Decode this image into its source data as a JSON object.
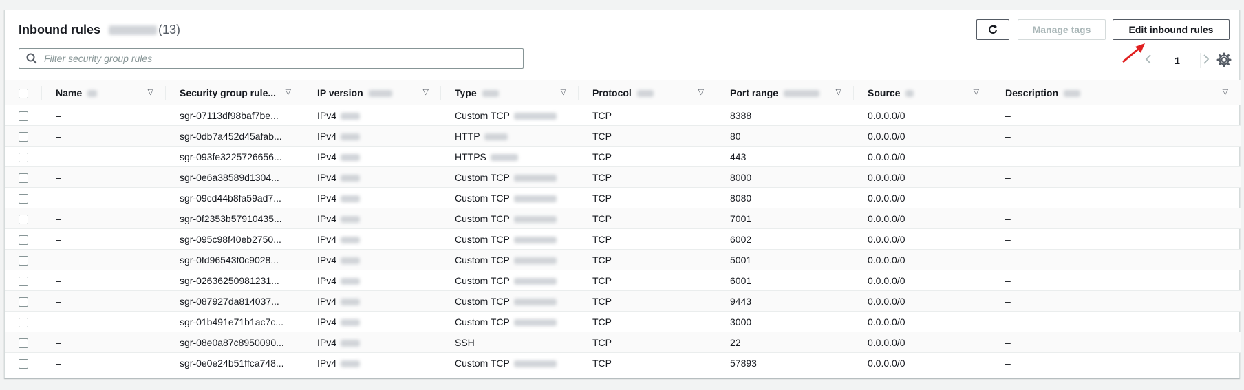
{
  "header": {
    "title": "Inbound rules",
    "count": "(13)"
  },
  "toolbar": {
    "manage_tags_label": "Manage tags",
    "edit_inbound_label": "Edit inbound rules"
  },
  "search": {
    "placeholder": "Filter security group rules"
  },
  "pagination": {
    "current_page": "1"
  },
  "table": {
    "columns": [
      "Name",
      "Security group rule...",
      "IP version",
      "Type",
      "Protocol",
      "Port range",
      "Source",
      "Description"
    ],
    "rows": [
      {
        "name": "–",
        "rule_id": "sgr-07113df98baf7be...",
        "ip_version": "IPv4",
        "type": "Custom TCP",
        "protocol": "TCP",
        "port_range": "8388",
        "source": "0.0.0.0/0",
        "description": "–"
      },
      {
        "name": "–",
        "rule_id": "sgr-0db7a452d45afab...",
        "ip_version": "IPv4",
        "type": "HTTP",
        "protocol": "TCP",
        "port_range": "80",
        "source": "0.0.0.0/0",
        "description": "–"
      },
      {
        "name": "–",
        "rule_id": "sgr-093fe3225726656...",
        "ip_version": "IPv4",
        "type": "HTTPS",
        "protocol": "TCP",
        "port_range": "443",
        "source": "0.0.0.0/0",
        "description": "–"
      },
      {
        "name": "–",
        "rule_id": "sgr-0e6a38589d1304...",
        "ip_version": "IPv4",
        "type": "Custom TCP",
        "protocol": "TCP",
        "port_range": "8000",
        "source": "0.0.0.0/0",
        "description": "–"
      },
      {
        "name": "–",
        "rule_id": "sgr-09cd44b8fa59ad7...",
        "ip_version": "IPv4",
        "type": "Custom TCP",
        "protocol": "TCP",
        "port_range": "8080",
        "source": "0.0.0.0/0",
        "description": "–"
      },
      {
        "name": "–",
        "rule_id": "sgr-0f2353b57910435...",
        "ip_version": "IPv4",
        "type": "Custom TCP",
        "protocol": "TCP",
        "port_range": "7001",
        "source": "0.0.0.0/0",
        "description": "–"
      },
      {
        "name": "–",
        "rule_id": "sgr-095c98f40eb2750...",
        "ip_version": "IPv4",
        "type": "Custom TCP",
        "protocol": "TCP",
        "port_range": "6002",
        "source": "0.0.0.0/0",
        "description": "–"
      },
      {
        "name": "–",
        "rule_id": "sgr-0fd96543f0c9028...",
        "ip_version": "IPv4",
        "type": "Custom TCP",
        "protocol": "TCP",
        "port_range": "5001",
        "source": "0.0.0.0/0",
        "description": "–"
      },
      {
        "name": "–",
        "rule_id": "sgr-02636250981231...",
        "ip_version": "IPv4",
        "type": "Custom TCP",
        "protocol": "TCP",
        "port_range": "6001",
        "source": "0.0.0.0/0",
        "description": "–"
      },
      {
        "name": "–",
        "rule_id": "sgr-087927da814037...",
        "ip_version": "IPv4",
        "type": "Custom TCP",
        "protocol": "TCP",
        "port_range": "9443",
        "source": "0.0.0.0/0",
        "description": "–"
      },
      {
        "name": "–",
        "rule_id": "sgr-01b491e71b1ac7c...",
        "ip_version": "IPv4",
        "type": "Custom TCP",
        "protocol": "TCP",
        "port_range": "3000",
        "source": "0.0.0.0/0",
        "description": "–"
      },
      {
        "name": "–",
        "rule_id": "sgr-08e0a87c8950090...",
        "ip_version": "IPv4",
        "type": "SSH",
        "protocol": "TCP",
        "port_range": "22",
        "source": "0.0.0.0/0",
        "description": "–"
      },
      {
        "name": "–",
        "rule_id": "sgr-0e0e24b51ffca748...",
        "ip_version": "IPv4",
        "type": "Custom TCP",
        "protocol": "TCP",
        "port_range": "57893",
        "source": "0.0.0.0/0",
        "description": "–"
      }
    ]
  },
  "icons": {
    "refresh": "refresh-icon",
    "search": "search-icon",
    "prev": "chevron-left-icon",
    "next": "chevron-right-icon",
    "settings": "gear-icon",
    "sort": "sort-down-icon"
  },
  "colors": {
    "annotation_arrow": "#e02020",
    "border": "#d5dbdb",
    "text": "#16191f"
  }
}
